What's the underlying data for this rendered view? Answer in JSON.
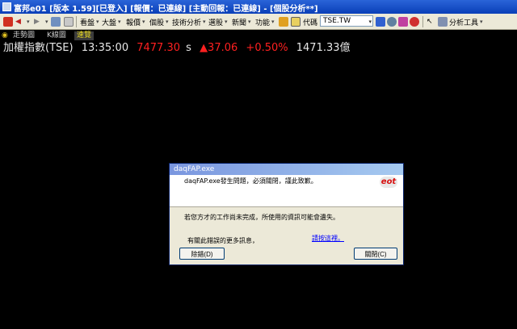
{
  "window": {
    "title": "富邦e01 [版本 1.59][已登入] [報價：已連線] [主動回報：已連線] - [個股分析**]"
  },
  "toolbar": {
    "menus": [
      "看盤",
      "大盤",
      "報價",
      "個股",
      "技術分析",
      "選股",
      "新聞",
      "功能"
    ],
    "code_label": "代碼",
    "code_value": "TSE.TW",
    "analysis_tools": "分析工具"
  },
  "tabs": [
    "走勢圖",
    "K線圖",
    "速覽"
  ],
  "quote": {
    "name": "加權指數(TSE)",
    "time": "13:35:00",
    "price": "7477.30",
    "price_flag": "s",
    "change": "▲37.06",
    "change_pct": "+0.50%",
    "volume": "1471.33億"
  },
  "dialog": {
    "title": "daqFAP.exe",
    "message": "daqFAP.exe發生問題，必須關閉，謹此致歉。",
    "logo": "eot",
    "warning": "若您方才的工作尚未完成，所使用的資訊可能會遺失。",
    "more_info": "有關此錯誤的更多訊息，",
    "link": "請按這裡。",
    "debug_button": "除錯(D)",
    "close_button": "關閉(C)"
  }
}
